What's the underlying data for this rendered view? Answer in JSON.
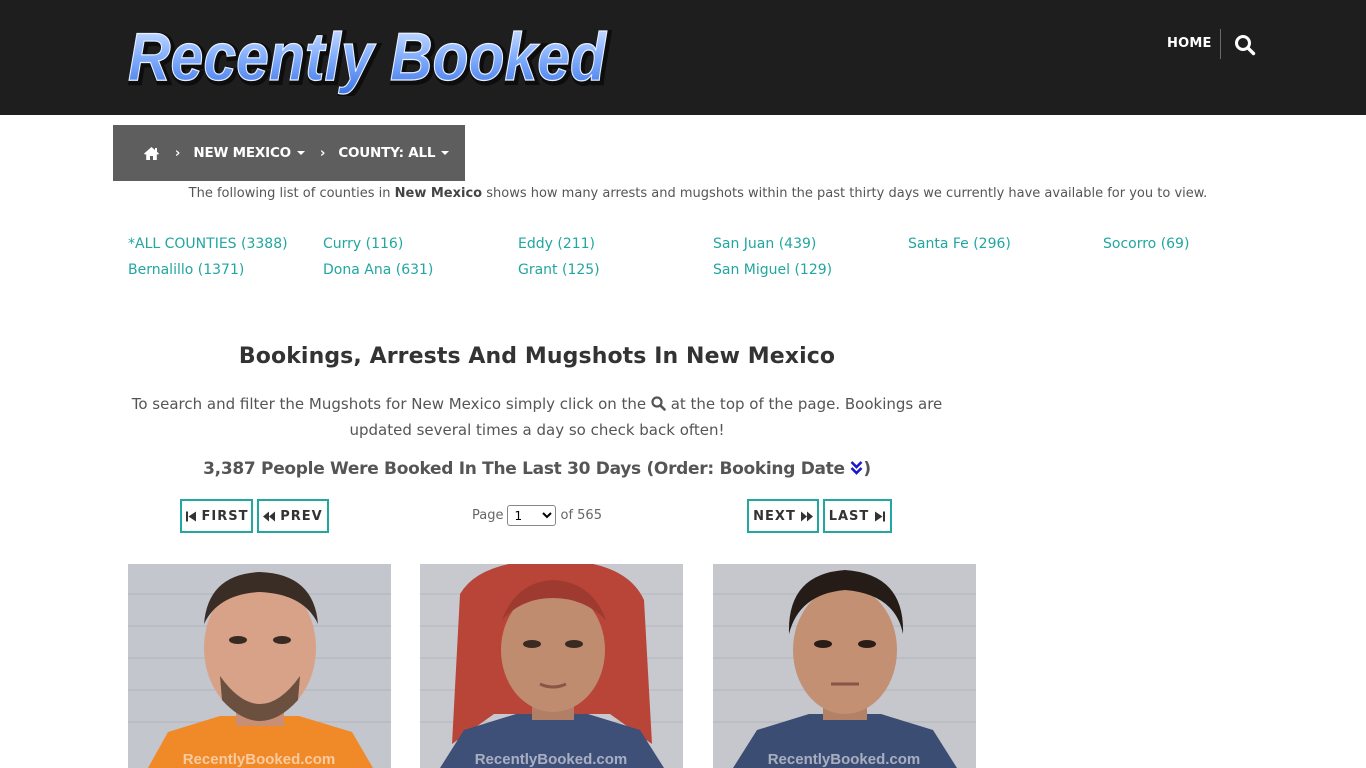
{
  "header": {
    "logo_text": "Recently Booked",
    "nav_home": "HOME",
    "search_icon": "search-icon"
  },
  "breadcrumb": {
    "home_icon": "home-icon",
    "state": "NEW MEXICO",
    "county": "COUNTY: ALL"
  },
  "intro": {
    "before": "The following list of counties in ",
    "state": "New Mexico",
    "after": " shows how many arrests and mugshots within the past thirty days we currently have available for you to view."
  },
  "counties": [
    "*ALL COUNTIES (3388)",
    "Curry (116)",
    "Eddy (211)",
    "San Juan (439)",
    "Santa Fe (296)",
    "Socorro (69)",
    "Bernalillo (1371)",
    "Dona Ana (631)",
    "Grant (125)",
    "San Miguel (129)"
  ],
  "main": {
    "title": "Bookings, Arrests And Mugshots In New Mexico",
    "desc_before": "To search and filter the Mugshots for New Mexico simply click on the ",
    "desc_after": " at the top of the page. Bookings are updated several times a day so check back often!",
    "booked_text": "3,387 People Were Booked In The Last 30 Days (Order: Booking Date ",
    "booked_close": ")"
  },
  "pagination": {
    "first": "FIRST",
    "prev": "PREV",
    "next": "NEXT",
    "last": "LAST",
    "page_label": "Page",
    "current_page": "1",
    "of_label": "of 565"
  },
  "mugshots": {
    "watermark": "RecentlyBooked.com"
  },
  "colors": {
    "header_bg": "#1e1e1e",
    "accent": "#22a6a0",
    "breadcrumb_bg": "#5e5e5e",
    "order_icon": "#1a1acc"
  }
}
